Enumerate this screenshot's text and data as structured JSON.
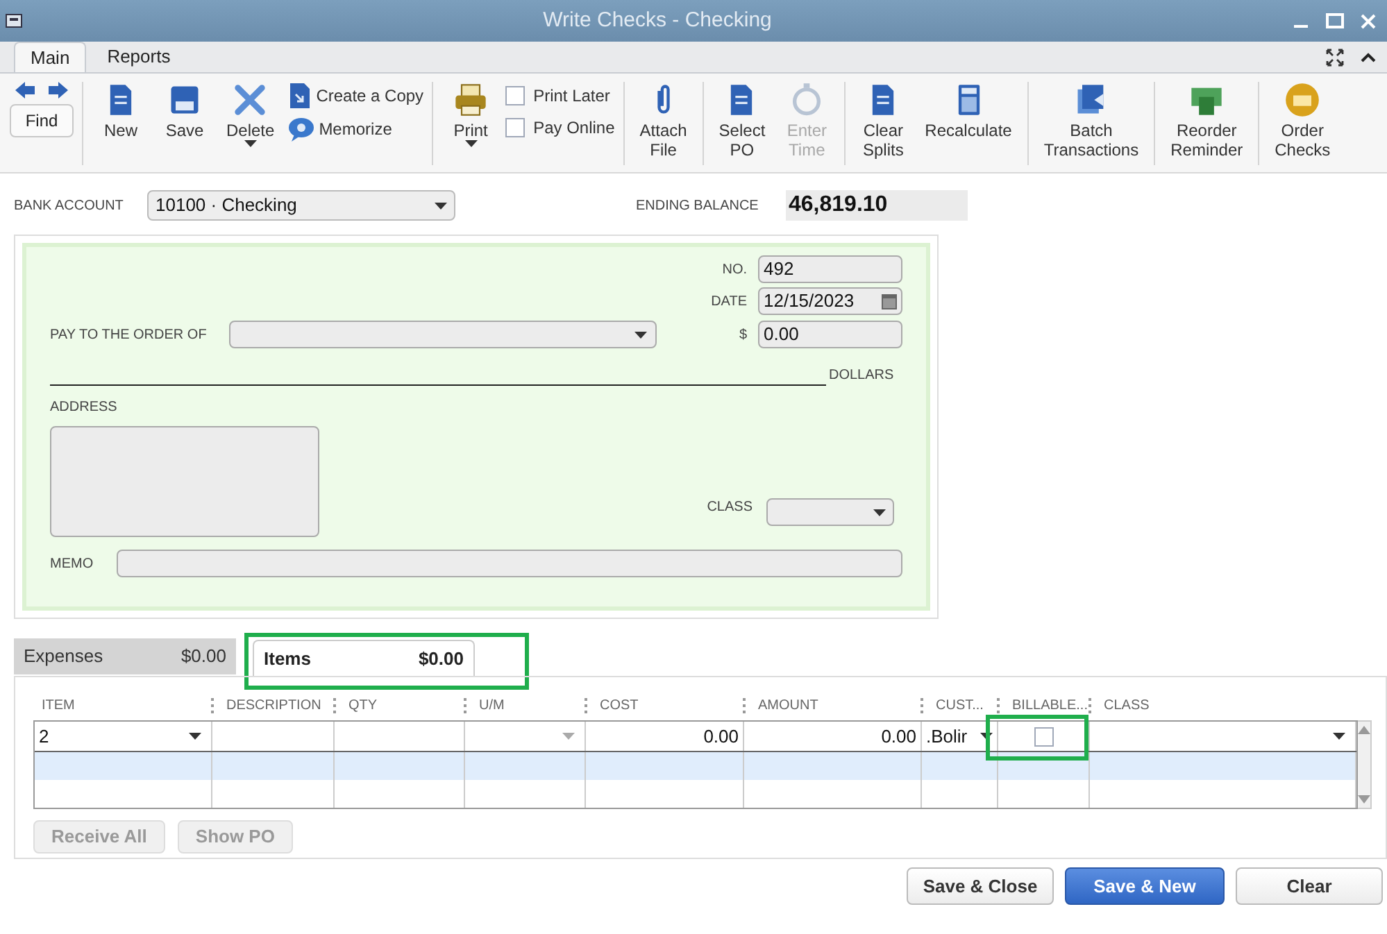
{
  "window": {
    "title": "Write Checks - Checking"
  },
  "ribbon_tabs": [
    {
      "label": "Main",
      "selected": true
    },
    {
      "label": "Reports",
      "selected": false
    }
  ],
  "toolbar": {
    "groups": [
      [
        {
          "kind": "nav",
          "label": "Find"
        }
      ],
      [
        {
          "kind": "large",
          "label": "New",
          "disabled": false,
          "dropdown": false
        },
        {
          "kind": "large",
          "label": "Save",
          "disabled": false,
          "dropdown": false
        },
        {
          "kind": "large",
          "label": "Delete",
          "disabled": false,
          "dropdown": true
        },
        {
          "kind": "stack",
          "items": [
            "Create a Copy",
            "Memorize"
          ]
        }
      ],
      [
        {
          "kind": "large",
          "label": "Print",
          "disabled": false,
          "dropdown": true
        },
        {
          "kind": "checks",
          "items": [
            {
              "label": "Print Later",
              "checked": false
            },
            {
              "label": "Pay Online",
              "checked": false
            }
          ]
        }
      ],
      [
        {
          "kind": "large",
          "label": "Attach\nFile",
          "disabled": false,
          "dropdown": false
        }
      ],
      [
        {
          "kind": "large",
          "label": "Select\nPO",
          "disabled": false,
          "dropdown": false
        },
        {
          "kind": "large",
          "label": "Enter\nTime",
          "disabled": true,
          "dropdown": false
        }
      ],
      [
        {
          "kind": "large",
          "label": "Clear\nSplits",
          "disabled": false,
          "dropdown": false
        },
        {
          "kind": "large",
          "label": "Recalculate",
          "disabled": false,
          "dropdown": false
        }
      ],
      [
        {
          "kind": "large",
          "label": "Batch\nTransactions",
          "disabled": false,
          "dropdown": false
        }
      ],
      [
        {
          "kind": "large",
          "label": "Reorder\nReminder",
          "disabled": false,
          "dropdown": false
        }
      ],
      [
        {
          "kind": "large",
          "label": "Order\nChecks",
          "disabled": false,
          "dropdown": false
        }
      ]
    ]
  },
  "bank_account": {
    "label": "BANK ACCOUNT",
    "value": "10100 · Checking"
  },
  "ending_balance": {
    "label": "ENDING BALANCE",
    "value": "46,819.10"
  },
  "check": {
    "no_label": "NO.",
    "no": "492",
    "date_label": "DATE",
    "date": "12/15/2023",
    "payee_label": "PAY TO THE ORDER OF",
    "amount_label": "$",
    "amount": "0.00",
    "dollars_label": "DOLLARS",
    "address_label": "ADDRESS",
    "class_label": "CLASS",
    "memo_label": "MEMO"
  },
  "detail_tabs": [
    {
      "label": "Expenses",
      "amount": "$0.00",
      "selected": false,
      "highlighted": false
    },
    {
      "label": "Items",
      "amount": "$0.00",
      "selected": true,
      "highlighted": true
    }
  ],
  "table": {
    "columns": [
      {
        "label": "ITEM",
        "highlighted": false
      },
      {
        "label": "DESCRIPTION",
        "highlighted": false
      },
      {
        "label": "QTY",
        "highlighted": false
      },
      {
        "label": "U/M",
        "highlighted": false
      },
      {
        "label": "COST",
        "highlighted": false
      },
      {
        "label": "AMOUNT",
        "highlighted": false
      },
      {
        "label": "CUST...",
        "highlighted": false
      },
      {
        "label": "BILLABLE...",
        "highlighted": true
      },
      {
        "label": "CLASS",
        "highlighted": false
      }
    ],
    "rows": [
      {
        "kind": "edit",
        "selected": false,
        "item": "2",
        "cost": "0.00",
        "amount": "0.00",
        "customer": ".Bolir",
        "billable": false
      },
      {
        "kind": "blank",
        "selected": true
      },
      {
        "kind": "blank",
        "selected": false
      }
    ]
  },
  "item_buttons": [
    {
      "label": "Receive All",
      "disabled": true
    },
    {
      "label": "Show PO",
      "disabled": true
    }
  ],
  "actions": [
    {
      "label": "Save & Close",
      "primary": false
    },
    {
      "label": "Save & New",
      "primary": true
    },
    {
      "label": "Clear",
      "primary": false
    }
  ]
}
